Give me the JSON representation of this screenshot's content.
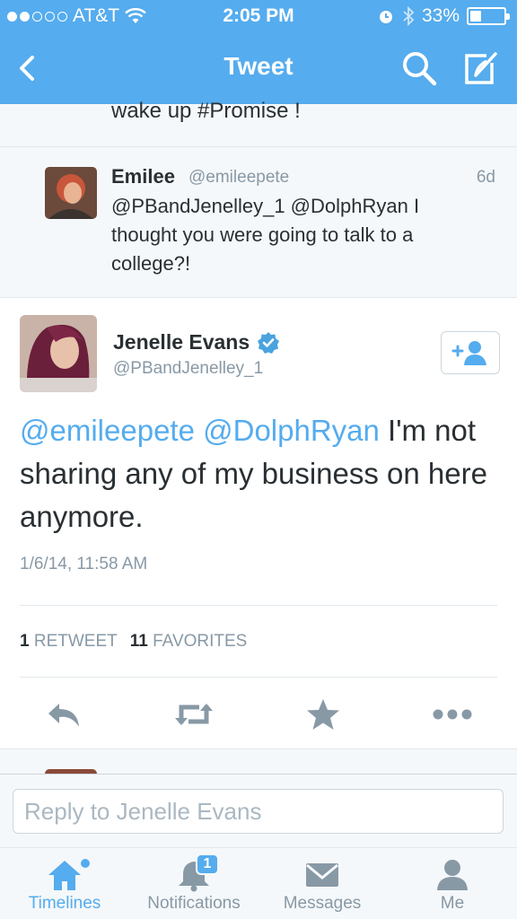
{
  "colors": {
    "brand": "#55acee",
    "text": "#292f33",
    "muted": "#8899a6",
    "divider": "#e1e8ed",
    "background_alt": "#f5f8fa"
  },
  "status_bar": {
    "carrier": "AT&T",
    "time": "2:05 PM",
    "battery_percent": "33%",
    "battery_level": 0.33,
    "signal_bars_filled": 2,
    "signal_bars_total": 5
  },
  "nav": {
    "title": "Tweet",
    "back_icon": "chevron-left-icon",
    "search_icon": "search-icon",
    "compose_icon": "compose-icon"
  },
  "previous_tweet": {
    "text_tail": "wake up #Promise !"
  },
  "reply_tweet": {
    "name": "Emilee",
    "handle": "@emileepete",
    "time": "6d",
    "text": "@PBandJenelley_1 @DolphRyan I thought you were going to talk to a college?!"
  },
  "main_tweet": {
    "name": "Jenelle Evans",
    "handle": "@PBandJenelley_1",
    "verified": true,
    "mention_1": "@emileepete",
    "mention_2": "@DolphRyan",
    "body_rest": " I'm not sharing any of my business on here anymore.",
    "date": "1/6/14, 11:58 AM",
    "retweets_count": "1",
    "retweets_label": "RETWEET",
    "favorites_count": "11",
    "favorites_label": "FAVORITES",
    "follow_icon": "add-user-icon",
    "actions": [
      "reply-icon",
      "retweet-icon",
      "favorite-icon",
      "more-icon"
    ]
  },
  "reply_bar": {
    "placeholder": "Reply to Jenelle Evans"
  },
  "tab_bar": {
    "tabs": [
      {
        "label": "Timelines",
        "icon": "home-icon",
        "active": true
      },
      {
        "label": "Notifications",
        "icon": "bell-icon",
        "badge": "1"
      },
      {
        "label": "Messages",
        "icon": "envelope-icon"
      },
      {
        "label": "Me",
        "icon": "person-icon"
      }
    ]
  }
}
